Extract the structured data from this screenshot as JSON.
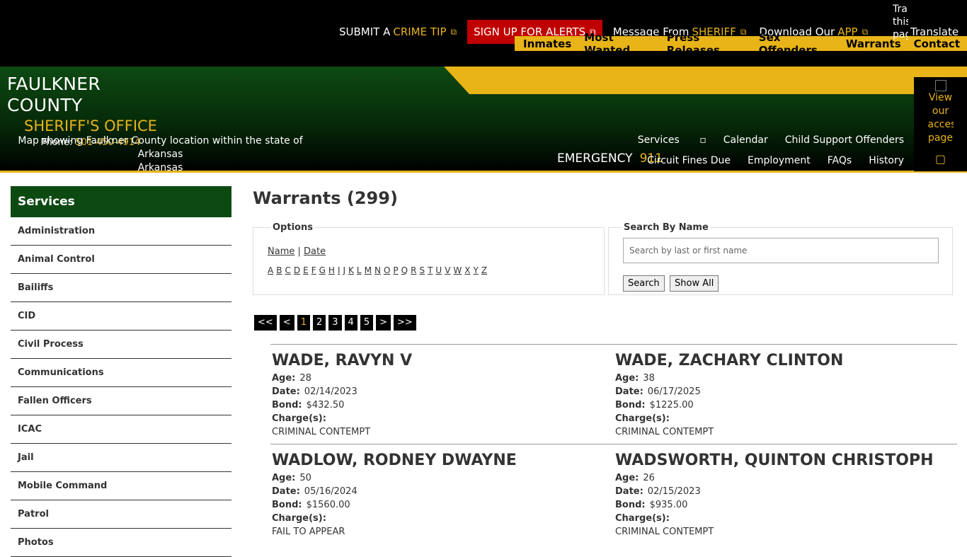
{
  "topbar": {
    "links": [
      {
        "pre": "SUBMIT A",
        "hl": "CRIME TIP",
        "icon": "external-link-icon"
      },
      {
        "pre": "SIGN UP FOR ALERTS",
        "hl": "",
        "icon": "external-link-icon"
      },
      {
        "pre": "Message From",
        "hl": "SHERIFF",
        "icon": "external-link-icon"
      },
      {
        "pre": "Download Our",
        "hl": "APP",
        "icon": "external-link-icon"
      }
    ],
    "translate_alt": "Translate this page",
    "translate_label": "Translate",
    "nav": [
      "Inmates",
      "Most Wanted",
      "Press Releases",
      "Sex Offenders",
      "Warrants",
      "Contact"
    ]
  },
  "header": {
    "county": "FAULKNER COUNTY",
    "office": "SHERIFF'S OFFICE",
    "phone_label": "Phone:",
    "phone": "501-450-4914",
    "map_alt": "Map showing Faulkner County location within the state of Arkansas",
    "map_sub": "Arkansas",
    "emergency_label": "EMERGENCY",
    "emergency_num": "911",
    "nav_top": [
      "Services",
      "Calendar",
      "Child Support Offenders"
    ],
    "nav_bottom": [
      "Circuit Fines Due",
      "Employment",
      "FAQs",
      "History"
    ],
    "access_text": "View our accessibility page"
  },
  "sidebar": {
    "title": "Services",
    "items": [
      "Administration",
      "Animal Control",
      "Bailiffs",
      "CID",
      "Civil Process",
      "Communications",
      "Fallen Officers",
      "ICAC",
      "Jail",
      "Mobile Command",
      "Patrol",
      "Photos"
    ]
  },
  "main": {
    "title": "Warrants (299)",
    "options_legend": "Options",
    "sort_name": "Name",
    "sort_sep": "|",
    "sort_date": "Date",
    "letters": [
      "A",
      "B",
      "C",
      "D",
      "E",
      "F",
      "G",
      "H",
      "I",
      "J",
      "K",
      "L",
      "M",
      "N",
      "O",
      "P",
      "Q",
      "R",
      "S",
      "T",
      "U",
      "V",
      "W",
      "X",
      "Y",
      "Z"
    ],
    "search_legend": "Search By Name",
    "search_placeholder": "Search by last or first name",
    "search_button": "Search",
    "showall_button": "Show All",
    "pager": [
      "<<",
      "<",
      "1",
      "2",
      "3",
      "4",
      "5",
      ">",
      ">>"
    ],
    "pager_current": "1",
    "labels": {
      "age": "Age:",
      "date": "Date:",
      "bond": "Bond:",
      "charges": "Charge(s):"
    },
    "records": [
      {
        "name": "WADE, RAVYN V",
        "age": "28",
        "date": "02/14/2023",
        "bond": "$432.50",
        "charge": "CRIMINAL CONTEMPT"
      },
      {
        "name": "WADE, ZACHARY CLINTON",
        "age": "38",
        "date": "06/17/2025",
        "bond": "$1225.00",
        "charge": "CRIMINAL CONTEMPT"
      },
      {
        "name": "WADLOW, RODNEY DWAYNE",
        "age": "50",
        "date": "05/16/2024",
        "bond": "$1560.00",
        "charge": "FAIL TO APPEAR"
      },
      {
        "name": "WADSWORTH, QUINTON CHRISTOPH",
        "age": "26",
        "date": "02/15/2023",
        "bond": "$935.00",
        "charge": "CRIMINAL CONTEMPT"
      }
    ]
  },
  "colors": {
    "gold": "#e8b418",
    "green": "#0d4a12",
    "alert_red": "#c00000"
  }
}
